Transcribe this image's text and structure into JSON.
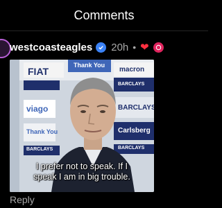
{
  "header": {
    "title": "Comments"
  },
  "comment": {
    "username": "westcoasteagles",
    "time": "20h",
    "separator": "•",
    "reply_label": "Reply",
    "gif": {
      "caption_line1": "I prefer not to speak. If I",
      "caption_line2": "speak I am in big trouble.",
      "sponsors": [
        "FIAT",
        "Thank You",
        "macron",
        "BARCLAYS",
        "viago",
        "BARCLAYS",
        "Thank You",
        "Carlsberg",
        "BARCLAYS",
        "BARCLAYS"
      ]
    }
  },
  "colors": {
    "background": "#000000",
    "verified": "#3b82f6",
    "heart": "#ff3040",
    "secondary_text": "#a8a8a8"
  },
  "icons": [
    "verified-badge-icon",
    "heart-icon",
    "creator-badge-icon"
  ]
}
